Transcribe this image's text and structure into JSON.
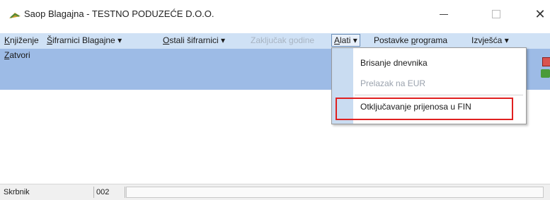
{
  "window": {
    "title": "Saop Blagajna - TESTNO PODUZEĆE D.O.O.",
    "minimize_glyph": "—",
    "maximize_glyph": "",
    "close_glyph": "✕"
  },
  "menu": {
    "items": [
      {
        "acc": "K",
        "rest": "njiženje",
        "arrow": ""
      },
      {
        "acc": "Š",
        "rest": "ifrarnici Blagajne",
        "arrow": "▾"
      },
      {
        "acc": "O",
        "rest": "stali šifrarnici",
        "arrow": "▾"
      },
      {
        "text": "Zaključak godine"
      },
      {
        "acc": "A",
        "rest": "lati",
        "arrow": "▾"
      },
      {
        "pre": "Postavke ",
        "acc": "p",
        "rest": "rograma"
      },
      {
        "text": "Izvješća",
        "arrow": "▾"
      }
    ]
  },
  "toolbar": {
    "close_acc": "Z",
    "close_rest": "atvori"
  },
  "dropdown": {
    "items": [
      {
        "label": "Brisanje dnevnika",
        "enabled": true
      },
      {
        "label": "Prelazak na EUR",
        "enabled": false
      },
      {
        "label": "Otključavanje prijenosa u FIN",
        "enabled": true
      }
    ]
  },
  "statusbar": {
    "user": "Skrbnik",
    "code": "002",
    "message": ""
  },
  "colors": {
    "menubar": "#cfe1f5",
    "toolbar": "#9dbbe6",
    "highlight_border": "#e02020"
  },
  "icons": [
    "app-icon",
    "minimize-icon",
    "maximize-icon",
    "close-icon",
    "toolbar-delete-icon",
    "toolbar-export-icon"
  ]
}
